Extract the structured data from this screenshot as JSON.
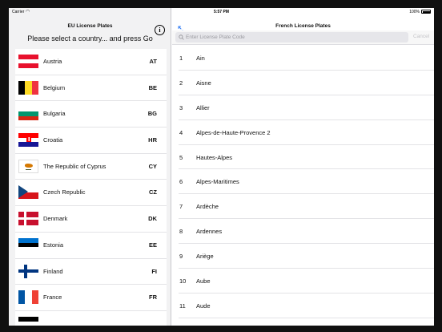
{
  "status_bar": {
    "carrier": "Carrier",
    "time": "5:57 PM",
    "battery": "100%"
  },
  "left_pane": {
    "title": "EU License Plates",
    "prompt": "Please select a country... and press Go",
    "countries": [
      {
        "name": "Austria",
        "code": "AT"
      },
      {
        "name": "Belgium",
        "code": "BE"
      },
      {
        "name": "Bulgaria",
        "code": "BG"
      },
      {
        "name": "Croatia",
        "code": "HR"
      },
      {
        "name": "The Republic of Cyprus",
        "code": "CY"
      },
      {
        "name": "Czech Republic",
        "code": "CZ"
      },
      {
        "name": "Denmark",
        "code": "DK"
      },
      {
        "name": "Estonia",
        "code": "EE"
      },
      {
        "name": "Finland",
        "code": "FI"
      },
      {
        "name": "France",
        "code": "FR"
      }
    ]
  },
  "right_pane": {
    "title": "French License Plates",
    "search": {
      "placeholder": "Enter License Plate Code",
      "value": ""
    },
    "cancel_label": "Cancel",
    "plates": [
      {
        "code": "1",
        "name": "Ain"
      },
      {
        "code": "2",
        "name": "Aisne"
      },
      {
        "code": "3",
        "name": "Allier"
      },
      {
        "code": "4",
        "name": "Alpes-de-Haute-Provence 2"
      },
      {
        "code": "5",
        "name": "Hautes-Alpes"
      },
      {
        "code": "6",
        "name": "Alpes-Maritimes"
      },
      {
        "code": "7",
        "name": "Ardèche"
      },
      {
        "code": "8",
        "name": "Ardennes"
      },
      {
        "code": "9",
        "name": "Ariège"
      },
      {
        "code": "10",
        "name": "Aube"
      },
      {
        "code": "11",
        "name": "Aude"
      }
    ]
  },
  "colors": {
    "accent": "#2f7bf5",
    "cancel_disabled": "#c4c4c8"
  }
}
